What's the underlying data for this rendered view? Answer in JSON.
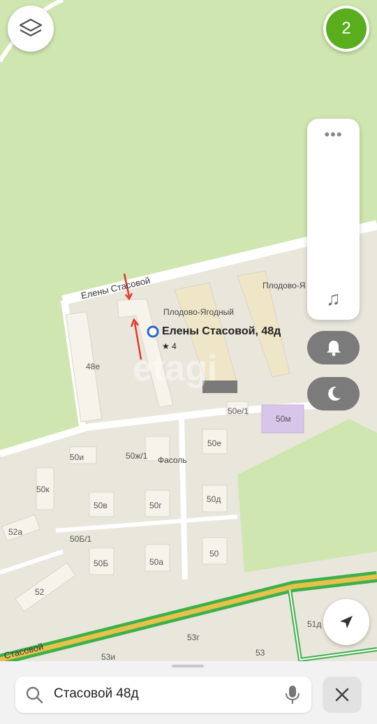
{
  "map": {
    "street_main": "Елены Стасовой",
    "street_bottom": "Стасовой",
    "buildings": {
      "b48e": "48е",
      "b50e1": "50е/1",
      "b50m": "50м",
      "b50i": "50и",
      "b50zh1": "50ж/1",
      "b50e": "50е",
      "b50k": "50к",
      "b50v": "50в",
      "b50g": "50г",
      "b50d": "50д",
      "b52a": "52а",
      "b50b1": "50Б/1",
      "b50b": "50Б",
      "b50a": "50а",
      "b50": "50",
      "b52": "52",
      "b53g": "53г",
      "b53i": "53и",
      "b53": "53",
      "b51d": "51д"
    },
    "poi_plodovo": "Плодово-Ягодный",
    "poi_plodovo2": "Плодово-Я",
    "poi_fasol": "Фасоль",
    "selected_address": "Елены Стасовой, 48д",
    "rating": "★ 4",
    "watermark": "etagi"
  },
  "controls": {
    "count": "2",
    "dots": "•••",
    "music_icon": "♫",
    "bell_icon": "bell-icon",
    "moon_icon": "moon-icon"
  },
  "search": {
    "value": "Стасовой 48д"
  },
  "colors": {
    "park": "#cfe6b0",
    "road": "#ffffff",
    "block": "#e9e6dc",
    "building": "#f6f3ea",
    "highlight_building": "#efe6c8",
    "major_road": "#e6c24b",
    "tram_green": "#3cb04a",
    "badge_green": "#5aae1e",
    "pin_blue": "#2a67c8",
    "arrow_red": "#e03a2a"
  }
}
